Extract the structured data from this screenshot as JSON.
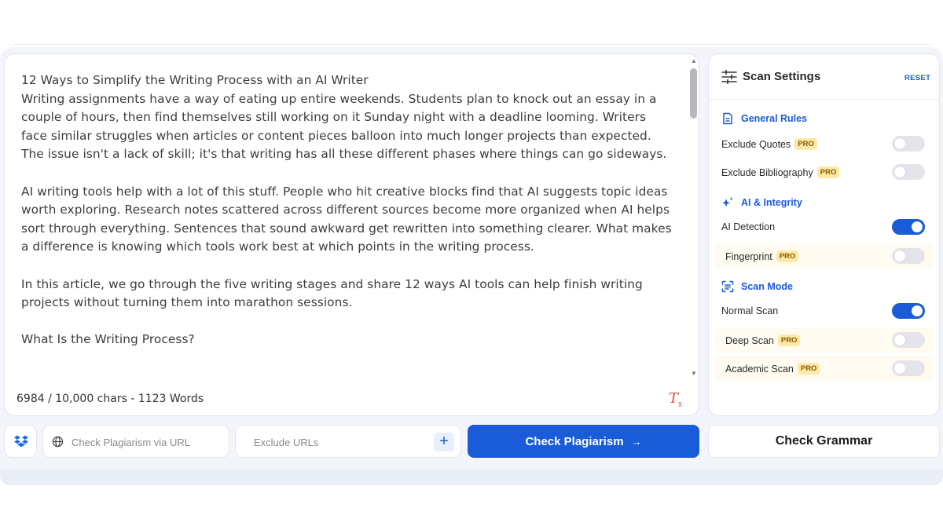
{
  "editor": {
    "paragraphs": [
      "12 Ways to Simplify the Writing Process with an AI Writer\nWriting assignments have a way of eating up entire weekends. Students plan to knock out an essay in a couple of hours, then find themselves still working on it Sunday night with a deadline looming. Writers face similar struggles when articles or content pieces balloon into much longer projects than expected. The issue isn't a lack of skill; it's that writing has all these different phases where things can go sideways.",
      "AI writing tools help with a lot of this stuff. People who hit creative blocks find that AI suggests topic ideas worth exploring. Research notes scattered across different sources become more organized when AI helps sort through everything. Sentences that sound awkward get rewritten into something clearer. What makes a difference is knowing which tools work best at which points in the writing process.",
      "In this article, we go through the five writing stages and share 12 ways AI tools can help finish writing projects without turning them into marathon sessions.",
      "What Is the Writing Process?"
    ],
    "char_count": "6984 / 10,000 chars - 1123 Words",
    "clear_format_label": "T",
    "clear_format_sub": "x"
  },
  "settings": {
    "title": "Scan Settings",
    "reset_label": "RESET",
    "pro_badge": "PRO",
    "sections": {
      "general": "General Rules",
      "ai": "AI & Integrity",
      "mode": "Scan Mode"
    },
    "options": {
      "exclude_quotes": {
        "label": "Exclude Quotes",
        "on": false
      },
      "exclude_bibliography": {
        "label": "Exclude Bibliography",
        "on": false
      },
      "ai_detection": {
        "label": "AI Detection",
        "on": true
      },
      "fingerprint": {
        "label": "Fingerprint",
        "on": false
      },
      "normal_scan": {
        "label": "Normal Scan",
        "on": true
      },
      "deep_scan": {
        "label": "Deep Scan",
        "on": false
      },
      "academic_scan": {
        "label": "Academic Scan",
        "on": false
      }
    }
  },
  "toolbar": {
    "url_placeholder": "Check Plagiarism via URL",
    "exclude_placeholder": "Exclude URLs",
    "plus_label": "+",
    "check_plagiarism_label": "Check Plagiarism",
    "check_plagiarism_arrow": "→",
    "check_grammar_label": "Check Grammar"
  },
  "colors": {
    "accent": "#1a5bd8",
    "pro_badge_bg": "#fde9a7",
    "clear_format": "#e04848"
  }
}
